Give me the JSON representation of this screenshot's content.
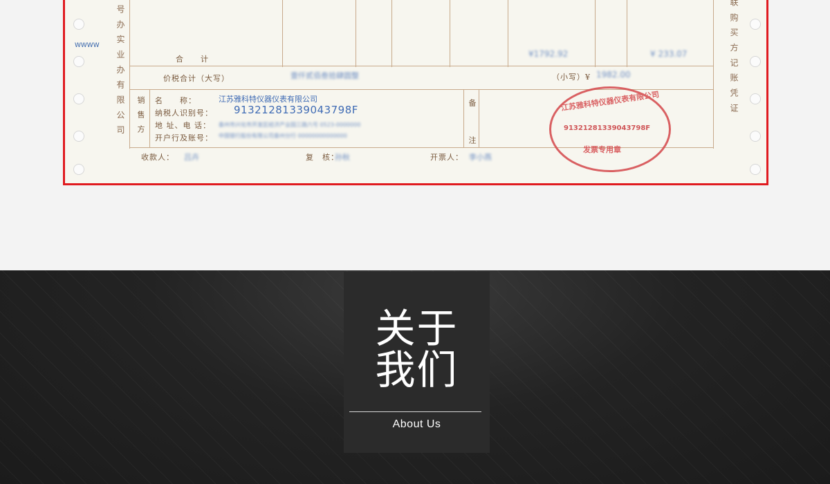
{
  "invoice": {
    "side_left_text": "号 办 实 业 办 有 限 公 司",
    "side_right_text": "联 购 买 方 记 账 凭 证",
    "side_marks": "WWWW",
    "total_label": "合　　计",
    "total_amount_blurred": "¥1792.92",
    "total_tax_blurred": "¥ 233.07",
    "tax_total_label": "价税合计（大写）",
    "tax_total_words_blurred": "壹仟贰佰叁拾肆圆整",
    "small_label": "（小写）¥",
    "small_amount_blurred": "1982.00",
    "seller_group_label": "销售方",
    "name_label": "名　　称：",
    "seller_name": "江苏雅科特仪器仪表有限公司",
    "tax_id_label": "纳税人识别号：",
    "seller_tax_id": "91321281339043798F",
    "address_label": "地 址、电 话：",
    "seller_address_blurred": "泰州市兴化市开发区经济产业园三路六号 0523-0000000",
    "bank_label": "开户行及账号：",
    "seller_bank_blurred": "中国银行股份有限公司泰州分行 00000000000000",
    "remarks_label": "备　注",
    "payee_label": "收款人：",
    "payee_blurred": "吕卉",
    "review_label": "复　核：",
    "review_blurred": "孙秋",
    "issuer_label": "开票人：",
    "issuer_blurred": "李小燕",
    "seller_group_label_short": "销"
  },
  "stamp": {
    "company": "江苏雅科特仪器仪表有限公司",
    "number": "91321281339043798F",
    "type": "发票专用章",
    "color": "#d4474a"
  },
  "about": {
    "title_line1": "关于",
    "title_line2": "我们",
    "subtitle": "About Us"
  }
}
